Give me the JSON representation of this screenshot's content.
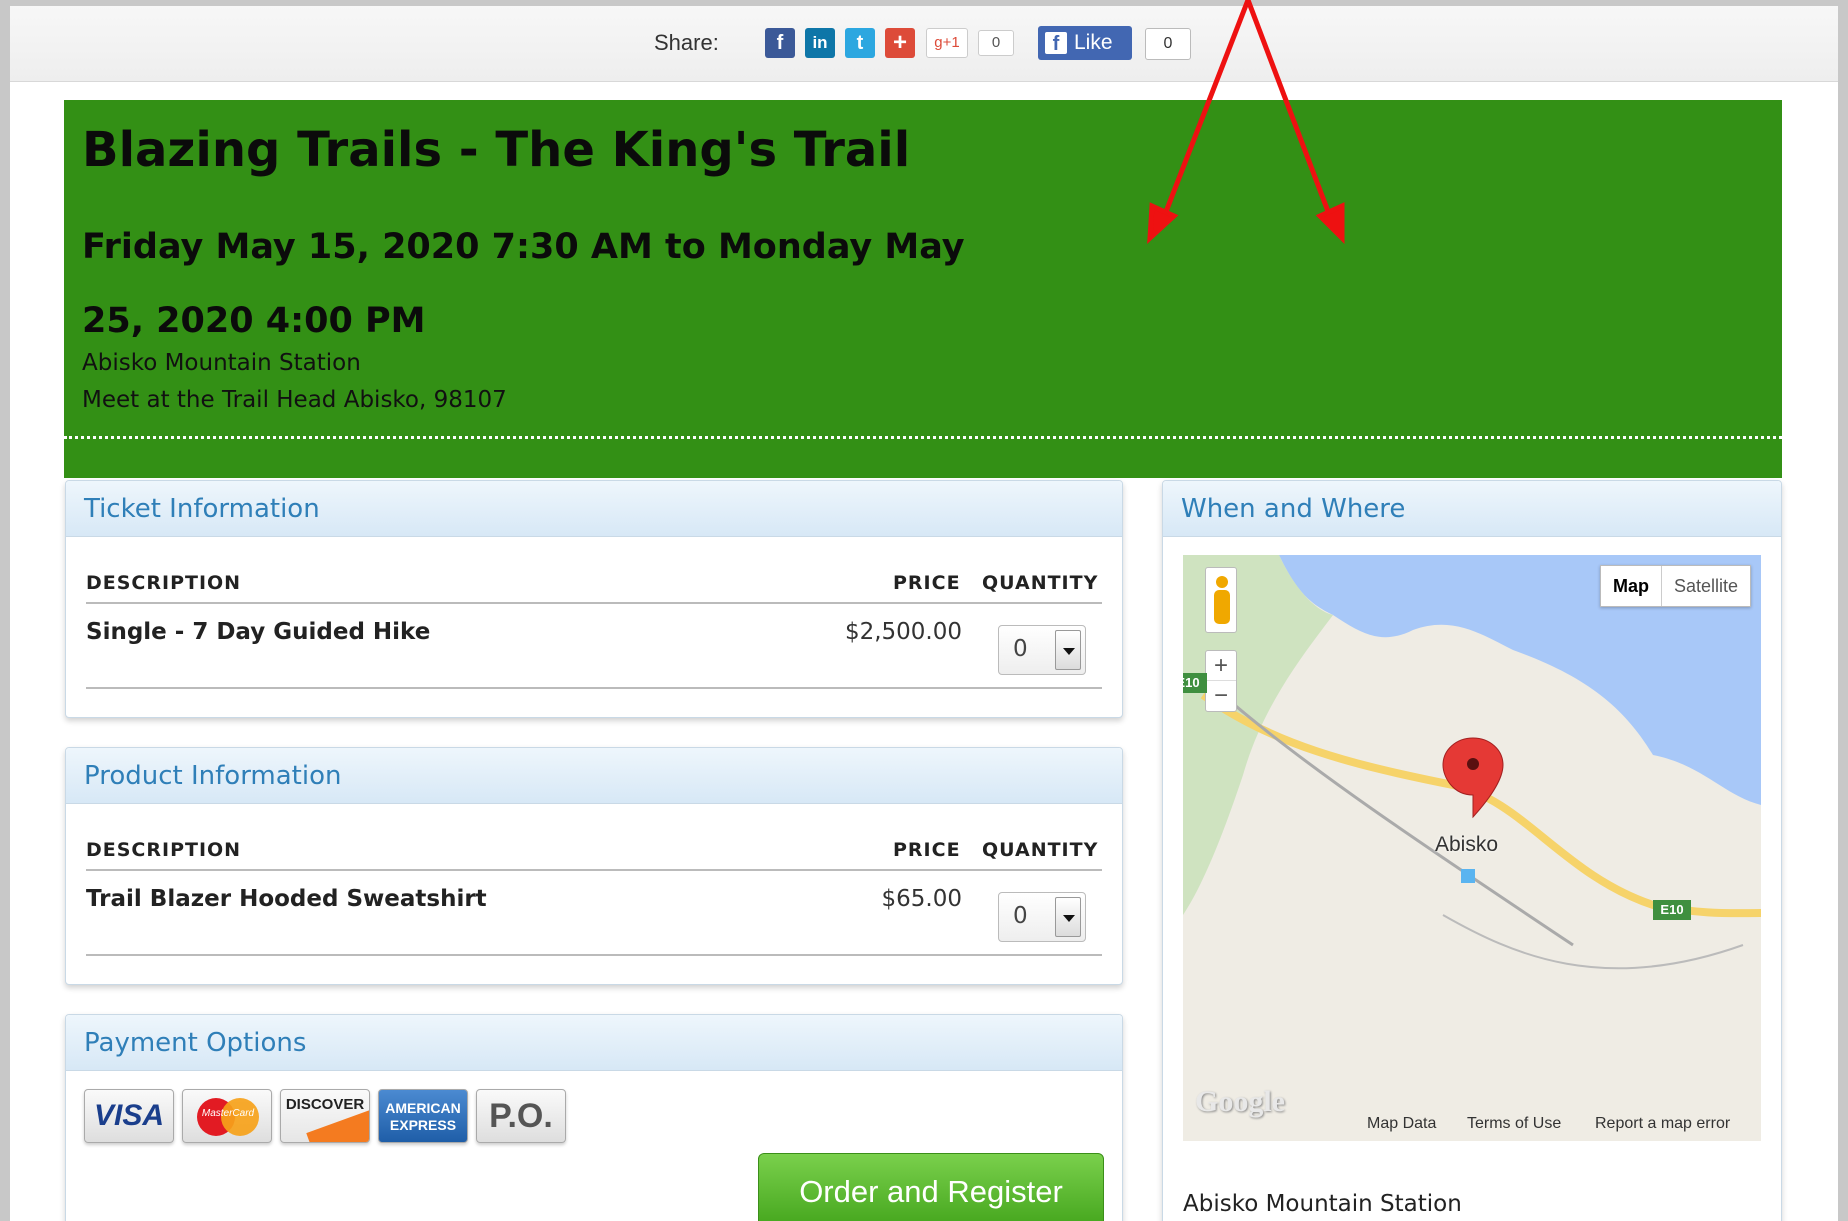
{
  "share": {
    "label": "Share:",
    "icons": [
      {
        "name": "facebook-icon",
        "glyph": "f"
      },
      {
        "name": "linkedin-icon",
        "glyph": "in"
      },
      {
        "name": "twitter-icon",
        "glyph": "t"
      },
      {
        "name": "google-plus-icon",
        "glyph": "+"
      }
    ],
    "gplus_label": "g+1",
    "gplus_count": "0",
    "like_label": "Like",
    "like_count": "0"
  },
  "event": {
    "title": "Blazing Trails - The King's Trail",
    "date": "Friday May 15, 2020 7:30 AM to Monday May 25, 2020 4:00 PM",
    "venue": "Abisko Mountain Station",
    "address": "Meet at the Trail Head Abisko, 98107",
    "banner_color": "#339015"
  },
  "tickets": {
    "title": "Ticket Information",
    "headers": {
      "description": "DESCRIPTION",
      "price": "PRICE",
      "quantity": "QUANTITY"
    },
    "rows": [
      {
        "name": "Single - 7 Day Guided Hike",
        "price": "$2,500.00",
        "quantity": "0"
      }
    ]
  },
  "products": {
    "title": "Product Information",
    "headers": {
      "description": "DESCRIPTION",
      "price": "PRICE",
      "quantity": "QUANTITY"
    },
    "rows": [
      {
        "name": "Trail Blazer Hooded Sweatshirt",
        "price": "$65.00",
        "quantity": "0"
      }
    ]
  },
  "payment": {
    "title": "Payment Options",
    "cards": {
      "visa": "VISA",
      "mastercard": "MasterCard",
      "discover": "DISCOVER",
      "amex": "AMERICAN EXPRESS",
      "po": "P.O."
    },
    "order_button": "Order and Register",
    "order_color": "#4fb226"
  },
  "when_where": {
    "title": "When and Where",
    "map": {
      "type_map": "Map",
      "type_satellite": "Satellite",
      "zoom_in": "+",
      "zoom_out": "−",
      "place_label": "Abisko",
      "road_label": "E10",
      "logo": "Google",
      "footer_data": "Map Data",
      "footer_terms": "Terms of Use",
      "footer_report": "Report a map error"
    },
    "venue": "Abisko Mountain Station"
  },
  "annotation": {
    "arrow_color": "#ee1111"
  }
}
